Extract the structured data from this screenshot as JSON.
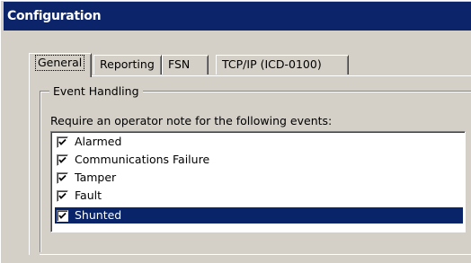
{
  "window": {
    "title": "Configuration"
  },
  "tabs": [
    {
      "label": "General",
      "active": true
    },
    {
      "label": "Reporting",
      "active": false
    },
    {
      "label": "FSN",
      "active": false
    },
    {
      "label": "TCP/IP (ICD-0100)",
      "active": false
    }
  ],
  "event_handling": {
    "group_label": "Event Handling",
    "prompt": "Require an operator note for the following events:",
    "items": [
      {
        "label": "Alarmed",
        "checked": true,
        "selected": false
      },
      {
        "label": "Communications Failure",
        "checked": true,
        "selected": false
      },
      {
        "label": "Tamper",
        "checked": true,
        "selected": false
      },
      {
        "label": "Fault",
        "checked": true,
        "selected": false
      },
      {
        "label": "Shunted",
        "checked": true,
        "selected": true
      }
    ]
  },
  "colors": {
    "titlebar": "#0b246a",
    "selection": "#0a246a",
    "face": "#d4d0c8"
  },
  "icons": {
    "check": "checkmark-icon"
  }
}
